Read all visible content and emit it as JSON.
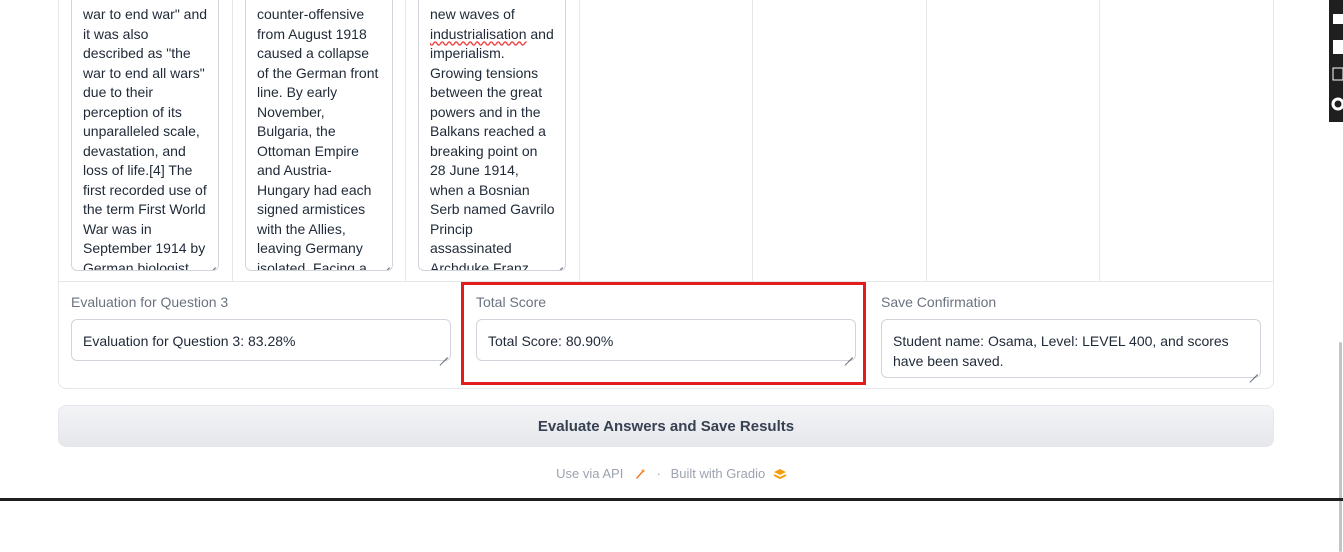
{
  "columns": [
    {
      "text": "war to end war\" and it was also described as \"the war to end all wars\" due to their perception of its unparalleled scale, devastation, and loss of life.[4] The first recorded use of the term First World War was in September 1914 by German biologist and philosopher Ernst"
    },
    {
      "text": "counter-offensive from August 1918 caused a collapse of the German front line. By early November, Bulgaria, the Ottoman Empire and Austria-Hungary had each signed armistices with the Allies, leaving Germany isolated. Facing a revolution at home, Kaiser"
    },
    {
      "pre": "new waves of ",
      "flagged": "industrialisation",
      "post": " and imperialism. Growing tensions between the great powers and in the Balkans reached a breaking point on 28 June 1914, when a Bosnian Serb named Gavrilo Princip assassinated Archduke Franz Ferdinand, heir to the AustroHungarian"
    }
  ],
  "eval_q3": {
    "label": "Evaluation for Question 3",
    "value": "Evaluation for Question 3: 83.28%"
  },
  "total_score": {
    "label": "Total Score",
    "value": "Total Score: 80.90%"
  },
  "save_confirmation": {
    "label": "Save Confirmation",
    "value": "Student name: Osama, Level: LEVEL 400, and scores have been saved."
  },
  "submit_button": "Evaluate Answers and Save Results",
  "footer": {
    "api": "Use via API",
    "separator": "·",
    "built": "Built with Gradio"
  }
}
